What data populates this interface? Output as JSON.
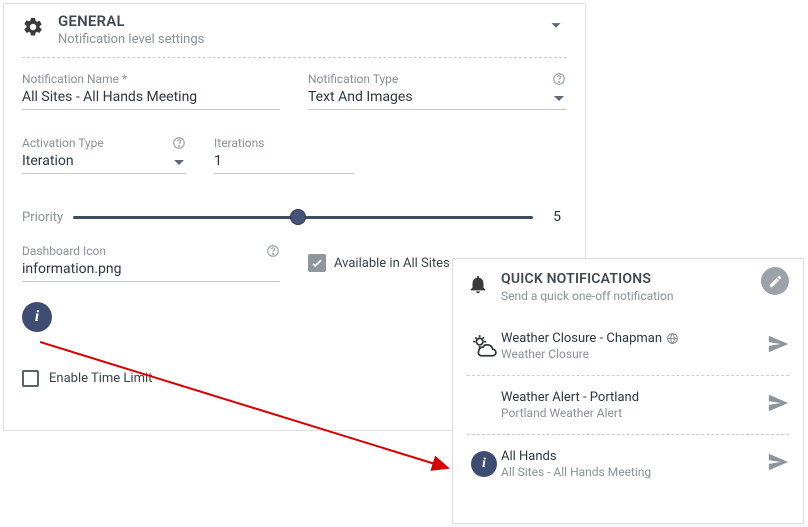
{
  "general": {
    "title": "GENERAL",
    "subtitle": "Notification level settings",
    "notificationName": {
      "label": "Notification Name *",
      "value": "All Sites - All Hands Meeting"
    },
    "notificationType": {
      "label": "Notification Type",
      "value": "Text And Images"
    },
    "activationType": {
      "label": "Activation Type",
      "value": "Iteration"
    },
    "iterations": {
      "label": "Iterations",
      "value": "1"
    },
    "priority": {
      "label": "Priority",
      "value": "5",
      "percent": 49
    },
    "dashboardIcon": {
      "label": "Dashboard Icon",
      "value": "information.png"
    },
    "availableAllSites": "Available in All Sites",
    "enableTimeLimit": "Enable Time Limit"
  },
  "quick": {
    "title": "QUICK NOTIFICATIONS",
    "subtitle": "Send a quick one-off notification",
    "items": [
      {
        "title": "Weather Closure - Chapman",
        "subtitle": "Weather Closure",
        "icon": "weather",
        "global": true
      },
      {
        "title": "Weather Alert - Portland",
        "subtitle": "Portland Weather Alert",
        "icon": "none",
        "global": false
      },
      {
        "title": "All Hands",
        "subtitle": "All Sites - All Hands Meeting",
        "icon": "info",
        "global": false
      }
    ]
  }
}
